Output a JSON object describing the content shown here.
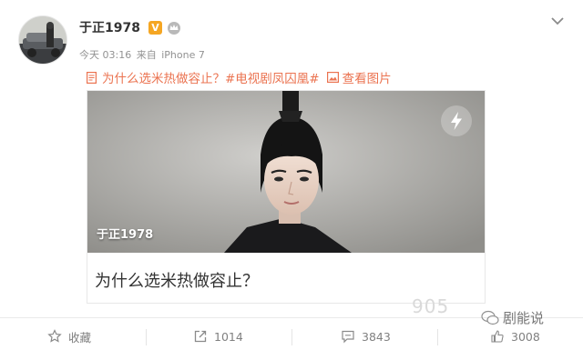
{
  "post": {
    "username": "于正1978",
    "verified_badge": "V",
    "time": "今天 03:16",
    "source_prefix": "来自",
    "device": "iPhone 7",
    "link_title": "为什么选米热做容止？",
    "hashtag": "#电视剧凤囚凰#",
    "view_image": "查看图片"
  },
  "card": {
    "caption": "于正1978",
    "title": "为什么选米热做容止？"
  },
  "actions": {
    "favorite": "收藏",
    "repost": "1014",
    "comment": "3843",
    "like": "3008"
  },
  "watermark": {
    "text": "剧能说",
    "ghost": "905"
  },
  "colors": {
    "link": "#eb7350",
    "badge": "#f5a623",
    "muted": "#929292"
  },
  "icons": [
    "chevron-down-icon",
    "verified-icon",
    "crown-icon",
    "document-icon",
    "image-icon",
    "bolt-icon",
    "star-icon",
    "repost-icon",
    "comment-icon",
    "like-icon"
  ]
}
